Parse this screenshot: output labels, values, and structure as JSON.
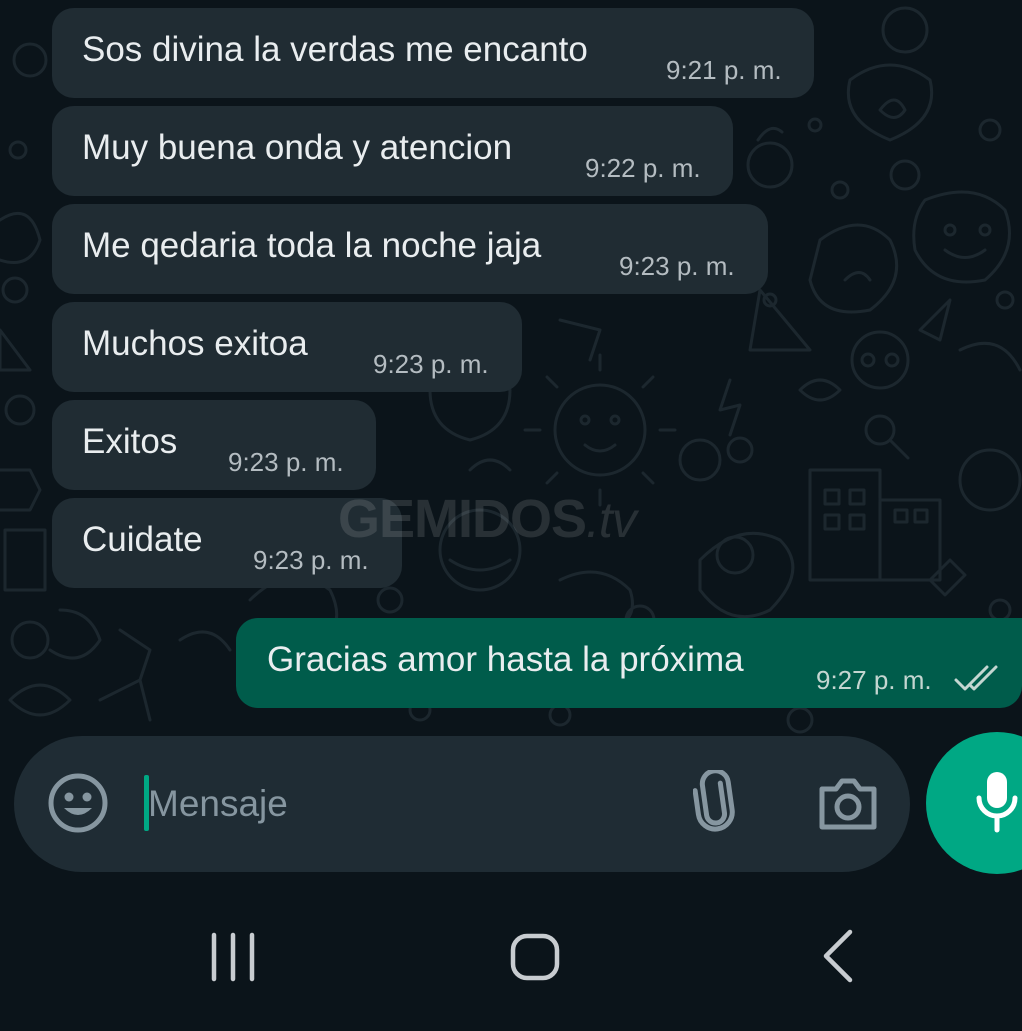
{
  "messages": [
    {
      "direction": "incoming",
      "text": "Sos divina la verdas me encanto",
      "time": "9:21 p. m."
    },
    {
      "direction": "incoming",
      "text": "Muy buena onda y atencion",
      "time": "9:22 p. m."
    },
    {
      "direction": "incoming",
      "text": "Me qedaria toda la noche jaja",
      "time": "9:23 p. m."
    },
    {
      "direction": "incoming",
      "text": "Muchos exitoa",
      "time": "9:23 p. m."
    },
    {
      "direction": "incoming",
      "text": "Exitos",
      "time": "9:23 p. m."
    },
    {
      "direction": "incoming",
      "text": "Cuidate",
      "time": "9:23 p. m."
    },
    {
      "direction": "outgoing",
      "text": "Gracias amor  hasta la próxima",
      "time": "9:27 p. m.",
      "status": "read-double-check-icon"
    }
  ],
  "watermark": {
    "name": "GEMIDOS",
    "tld": ".tv"
  },
  "composer": {
    "placeholder": "Mensaje",
    "emoji_icon": "emoji-icon",
    "attach_icon": "paperclip-icon",
    "camera_icon": "camera-icon",
    "mic_icon": "microphone-icon"
  },
  "navigation": {
    "recents_icon": "recents-icon",
    "home_icon": "home-icon",
    "back_icon": "back-icon"
  },
  "colors": {
    "background": "#0b141a",
    "incoming_bubble": "#202c33",
    "outgoing_bubble": "#005c4b",
    "accent": "#00a884",
    "text": "#e9edef",
    "timestamp": "#b4bcc1"
  }
}
